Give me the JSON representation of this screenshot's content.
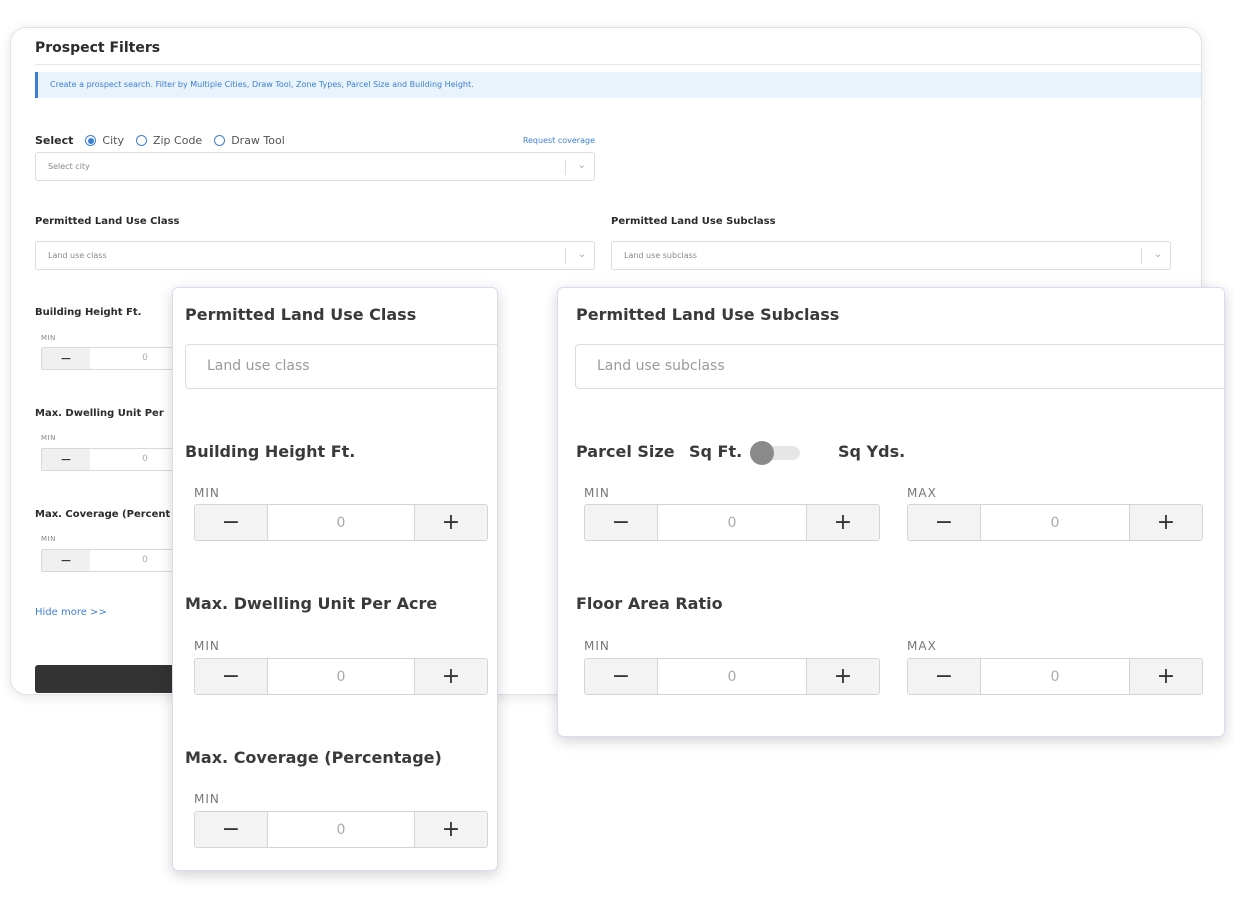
{
  "background": {
    "title": "Prospect Filters",
    "info_banner": "Create a prospect search. Filter by Multiple Cities, Draw Tool, Zone Types, Parcel Size and Building Height.",
    "select_label": "Select",
    "radio_options": [
      "City",
      "Zip Code",
      "Draw Tool"
    ],
    "selected_option": "City",
    "request_coverage": "Request coverage",
    "city_placeholder": "Select city",
    "land_use_class_label": "Permitted Land Use Class",
    "land_use_class_placeholder": "Land use class",
    "land_use_subclass_label": "Permitted Land Use Subclass",
    "land_use_subclass_placeholder": "Land use subclass",
    "building_height_label": "Building Height Ft.",
    "dwelling_label": "Max. Dwelling Unit Per",
    "coverage_label": "Max. Coverage (Percent",
    "min_label": "MIN",
    "stepper_value": "0",
    "hide_more": "Hide more >>"
  },
  "left_card": {
    "land_use_class_label": "Permitted Land Use Class",
    "land_use_class_placeholder": "Land use class",
    "building_height_label": "Building Height Ft.",
    "dwelling_label": "Max. Dwelling Unit Per Acre",
    "coverage_label": "Max. Coverage (Percentage)",
    "min_label": "MIN",
    "stepper_value": "0"
  },
  "right_card": {
    "land_use_subclass_label": "Permitted Land Use Subclass",
    "land_use_subclass_placeholder": "Land use subclass",
    "parcel_size_label": "Parcel Size",
    "unit_left": "Sq Ft.",
    "unit_right": "Sq Yds.",
    "toggle_state": "Sq Ft.",
    "floor_area_label": "Floor Area Ratio",
    "min_label": "MIN",
    "max_label": "MAX",
    "stepper_value": "0"
  },
  "stepper_icons": {
    "minus": "−",
    "plus": "+"
  },
  "select_icons": {
    "chevron": "⌄"
  },
  "colors": {
    "accent": "#3d7fd6",
    "banner_bg": "#e8f3fb",
    "toggle_knob": "#8a8a8a",
    "apply_button": "#333333"
  }
}
